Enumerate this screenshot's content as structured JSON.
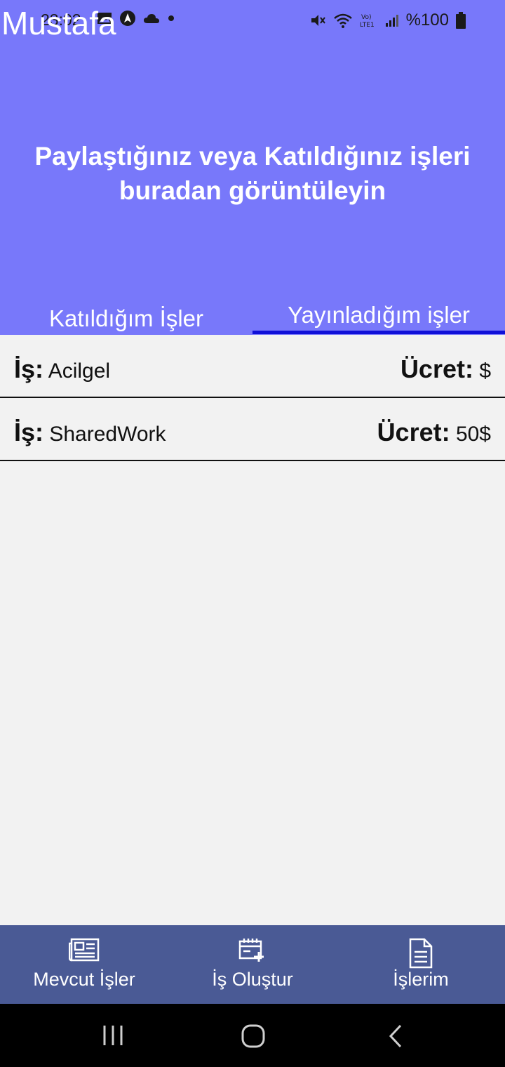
{
  "status_bar": {
    "time": "23:02",
    "battery": "%100",
    "icons": [
      "gallery-icon",
      "navigation-icon",
      "cloud-icon",
      "dot-icon",
      "mute-icon",
      "wifi-icon",
      "volte-icon",
      "signal-icon",
      "battery-icon"
    ]
  },
  "header": {
    "user_name": "Mustafa",
    "title": "Paylaştığınız veya Katıldığınız işleri buradan görüntüleyin"
  },
  "tabs": [
    {
      "label": "Katıldığım İşler",
      "selected": false
    },
    {
      "label": "Yayınladığım işler",
      "selected": true
    }
  ],
  "jobs": [
    {
      "job_key": "İş:",
      "job_name": "Acilgel",
      "fee_key": "Ücret:",
      "fee_value": "$"
    },
    {
      "job_key": "İş:",
      "job_name": "SharedWork",
      "fee_key": "Ücret:",
      "fee_value": "50$"
    }
  ],
  "bottom_nav": [
    {
      "label": "Mevcut İşler",
      "icon": "newspaper-icon"
    },
    {
      "label": "İş Oluştur",
      "icon": "calendar-add-icon"
    },
    {
      "label": "İşlerim",
      "icon": "document-icon"
    }
  ],
  "colors": {
    "header_bg": "#7878fa",
    "tab_indicator": "#1010d8",
    "bottom_nav_bg": "#4a5a95",
    "content_bg": "#f2f2f2"
  }
}
